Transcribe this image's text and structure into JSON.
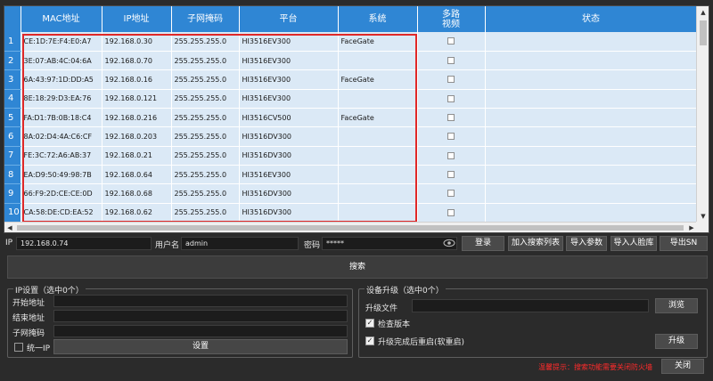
{
  "table": {
    "headers": [
      "MAC地址",
      "IP地址",
      "子网掩码",
      "平台",
      "系统",
      "多路\n视频",
      "状态"
    ],
    "rows": [
      {
        "num": "1",
        "mac": "CE:1D:7E:F4:E0:A7",
        "ip": "192.168.0.30",
        "mask": "255.255.255.0",
        "platform": "HI3516EV300",
        "system": "FaceGate"
      },
      {
        "num": "2",
        "mac": "3E:07:AB:4C:04:6A",
        "ip": "192.168.0.70",
        "mask": "255.255.255.0",
        "platform": "HI3516EV300",
        "system": ""
      },
      {
        "num": "3",
        "mac": "6A:43:97:1D:DD:A5",
        "ip": "192.168.0.16",
        "mask": "255.255.255.0",
        "platform": "HI3516EV300",
        "system": "FaceGate"
      },
      {
        "num": "4",
        "mac": "8E:18:29:D3:EA:76",
        "ip": "192.168.0.121",
        "mask": "255.255.255.0",
        "platform": "HI3516EV300",
        "system": ""
      },
      {
        "num": "5",
        "mac": "FA:D1:7B:0B:18:C4",
        "ip": "192.168.0.216",
        "mask": "255.255.255.0",
        "platform": "HI3516CV500",
        "system": "FaceGate"
      },
      {
        "num": "6",
        "mac": "8A:02:D4:4A:C6:CF",
        "ip": "192.168.0.203",
        "mask": "255.255.255.0",
        "platform": "HI3516DV300",
        "system": ""
      },
      {
        "num": "7",
        "mac": "FE:3C:72:A6:AB:37",
        "ip": "192.168.0.21",
        "mask": "255.255.255.0",
        "platform": "HI3516DV300",
        "system": ""
      },
      {
        "num": "8",
        "mac": "EA:D9:50:49:98:7B",
        "ip": "192.168.0.64",
        "mask": "255.255.255.0",
        "platform": "HI3516EV300",
        "system": ""
      },
      {
        "num": "9",
        "mac": "66:F9:2D:CE:CE:0D",
        "ip": "192.168.0.68",
        "mask": "255.255.255.0",
        "platform": "HI3516DV300",
        "system": ""
      },
      {
        "num": "10",
        "mac": "CA:58:DE:CD:EA:52",
        "ip": "192.168.0.62",
        "mask": "255.255.255.0",
        "platform": "HI3516DV300",
        "system": ""
      }
    ]
  },
  "login": {
    "ip_label": "IP",
    "ip_value": "192.168.0.74",
    "user_label": "用户名",
    "user_value": "admin",
    "pwd_label": "密码",
    "pwd_value": "*****",
    "buttons": [
      "登录",
      "加入搜索列表",
      "导入参数",
      "导入人脸库",
      "导出SN"
    ]
  },
  "search_label": "搜索",
  "ip_settings": {
    "title": "IP设置（选中0个）",
    "start_label": "开始地址",
    "end_label": "结束地址",
    "mask_label": "子网掩码",
    "unify_label": "统一IP",
    "unify_checked": false,
    "set_button": "设置"
  },
  "upgrade": {
    "title": "设备升级（选中0个）",
    "file_label": "升级文件",
    "browse_button": "浏览",
    "check_version_label": "检查版本",
    "check_version_checked": true,
    "reboot_label": "升级完成后重启(软重启)",
    "reboot_checked": true,
    "upgrade_button": "升级"
  },
  "hint": "温馨提示：搜索功能需要关闭防火墙",
  "close_button": "关闭",
  "colors": {
    "accent": "#2f86d4",
    "highlight_box": "#e02828",
    "hint": "#ff2b2b",
    "row_bg": "#dbe9f6"
  },
  "icons": {
    "password_toggle": "eye-icon"
  }
}
